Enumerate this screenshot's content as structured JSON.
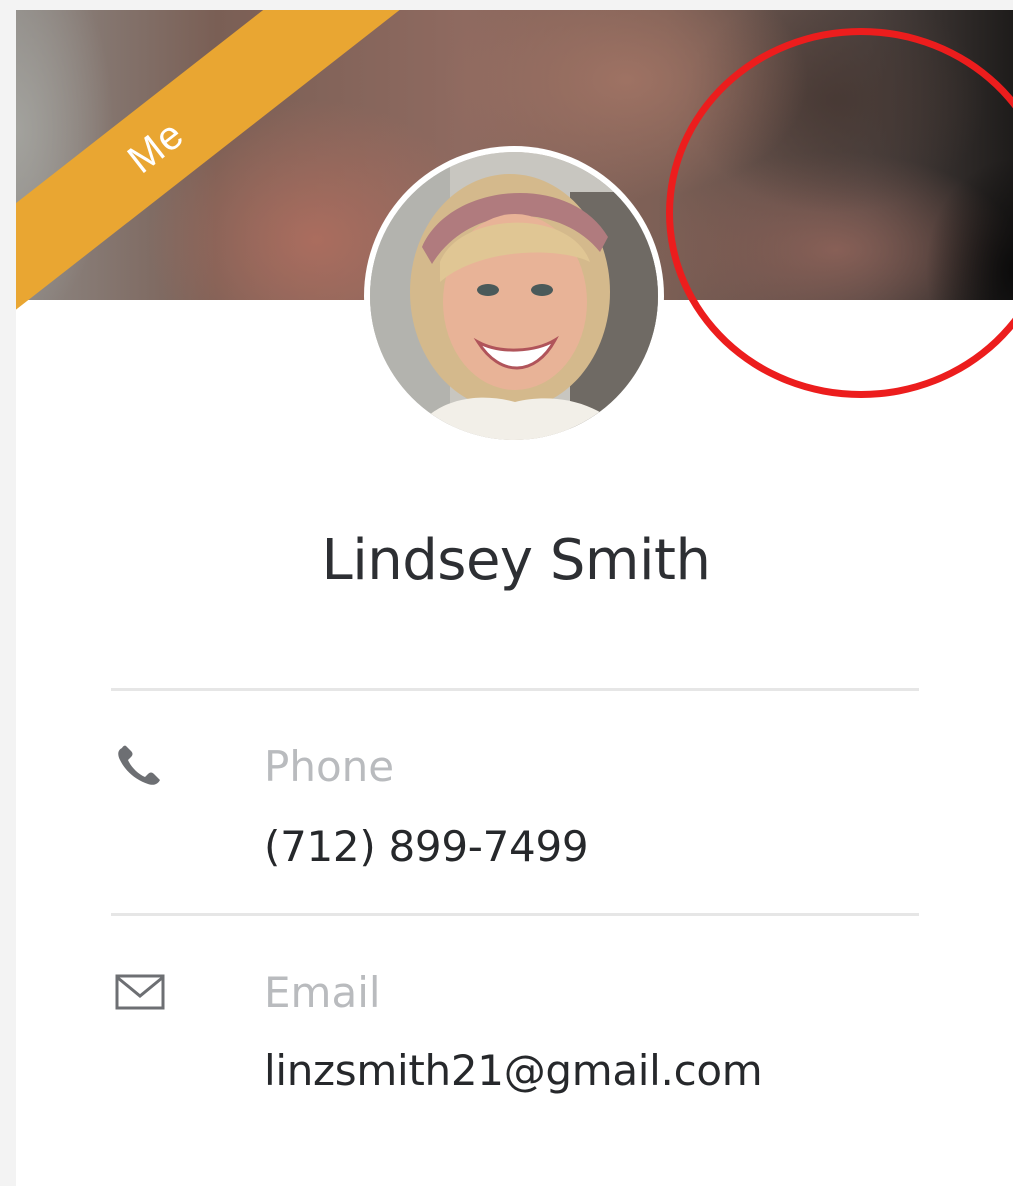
{
  "profile": {
    "badge": "Me",
    "name": "Lindsey Smith"
  },
  "contact": {
    "phone": {
      "icon": "phone-icon",
      "label": "Phone",
      "value": "(712) 899-7499"
    },
    "email": {
      "icon": "envelope-icon",
      "label": "Email",
      "value": "linzsmith21@gmail.com"
    }
  },
  "colors": {
    "ribbon": "#e9a632",
    "annotation": "#ec1d1d",
    "label_text": "#b9bbbe",
    "value_text": "#26282b"
  }
}
